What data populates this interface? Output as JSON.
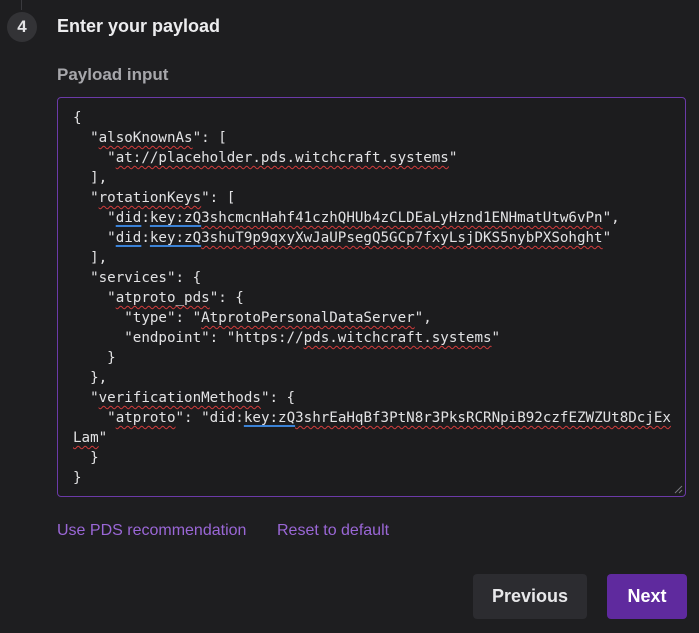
{
  "step": {
    "number": "4",
    "title": "Enter your payload"
  },
  "payload": {
    "label": "Payload input",
    "lines": {
      "l01": "{",
      "l02a": "  \"",
      "l02b": "alsoKnownAs",
      "l02c": "\": [",
      "l03a": "    \"",
      "l03b": "at://placeholder.pds.witchcraft.systems",
      "l03c": "\"",
      "l04": "  ],",
      "l05a": "  \"",
      "l05b": "rotationKeys",
      "l05c": "\": [",
      "l06a": "    \"",
      "l06b": "did",
      "l06c": ":",
      "l06d": "key:zQ",
      "l06e": "3shcmcnHahf41czhQHUb4zCLDEaLyHznd1ENHmatUtw6vPn",
      "l06f": "\",",
      "l07a": "    \"",
      "l07b": "did",
      "l07c": ":",
      "l07d": "key:zQ",
      "l07e": "3shuT9p9qxyXwJaUPsegQ5GCp7fxyLsjDKS5nybPXSohght",
      "l07f": "\"",
      "l08": "  ],",
      "l09": "  \"services\": {",
      "l10a": "    \"",
      "l10b": "atproto_pds",
      "l10c": "\": {",
      "l11a": "      \"type\": \"",
      "l11b": "AtprotoPersonalDataServer",
      "l11c": "\",",
      "l12a": "      \"endpoint\": \"https://",
      "l12b": "pds.witchcraft.systems",
      "l12c": "\"",
      "l13": "    }",
      "l14": "  },",
      "l15a": "  \"",
      "l15b": "verificationMethods",
      "l15c": "\": {",
      "l16a": "    \"",
      "l16b": "atproto",
      "l16c": "\": \"did:",
      "l16d": "key:zQ",
      "l16e": "3shrEaHqBf3PtN8r3PksRCRNpiB92czfEZWZUt8DcjExLam",
      "l16f": "\"",
      "l17": "  }",
      "l18": "}"
    }
  },
  "actions": {
    "recommend_link": "Use PDS recommendation",
    "reset_link": "Reset to default",
    "previous_label": "Previous",
    "next_label": "Next"
  },
  "colors": {
    "accent": "#5f2a9e",
    "link": "#9a67d6",
    "spellcheck": "#d23c3c",
    "grammar": "#3b82d6"
  },
  "icons": {
    "resize": "resize-grip-icon"
  }
}
